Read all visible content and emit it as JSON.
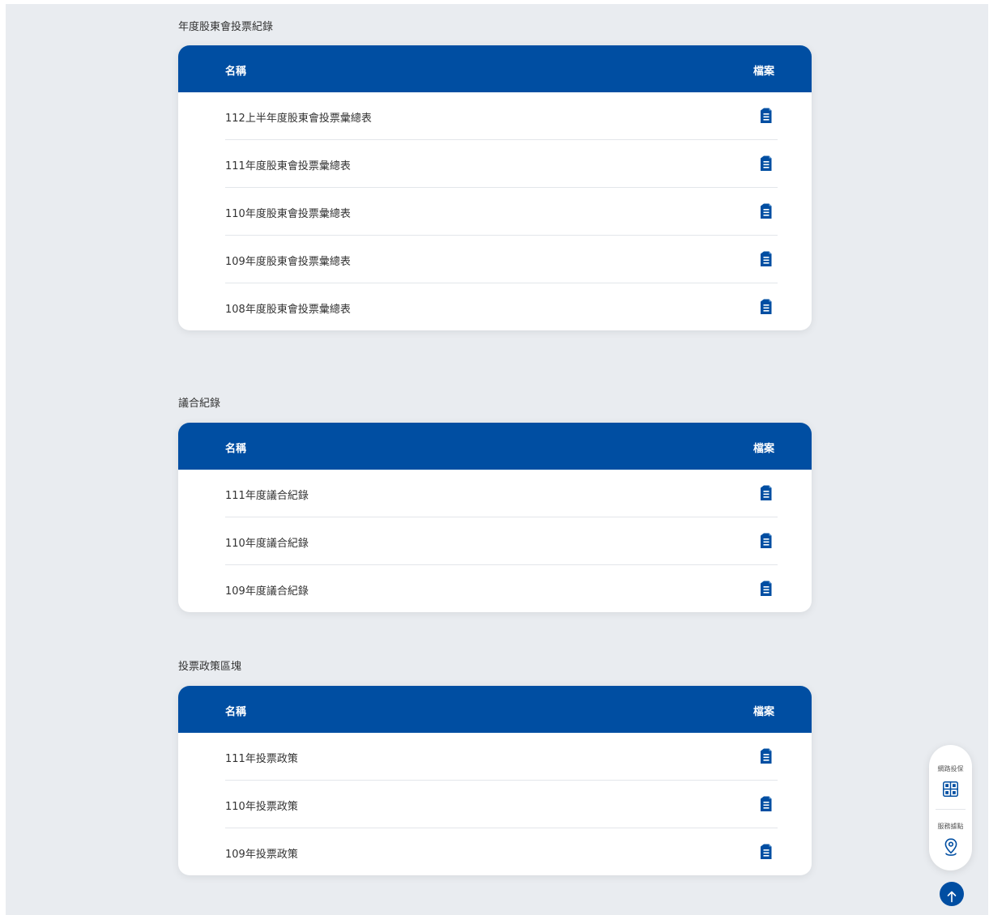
{
  "sections": [
    {
      "title": "年度股東會投票紀錄",
      "header": {
        "name": "名稱",
        "file": "檔案"
      },
      "rows": [
        {
          "name": "112上半年度股東會投票彙總表",
          "file_icon": "document-icon"
        },
        {
          "name": "111年度股東會投票彙總表",
          "file_icon": "document-icon"
        },
        {
          "name": "110年度股東會投票彙總表",
          "file_icon": "document-icon"
        },
        {
          "name": "109年度股東會投票彙總表",
          "file_icon": "document-icon"
        },
        {
          "name": "108年度股東會投票彙總表",
          "file_icon": "document-icon"
        }
      ]
    },
    {
      "title": "議合紀錄",
      "header": {
        "name": "名稱",
        "file": "檔案"
      },
      "rows": [
        {
          "name": "111年度議合紀錄",
          "file_icon": "document-icon"
        },
        {
          "name": "110年度議合紀錄",
          "file_icon": "document-icon"
        },
        {
          "name": "109年度議合紀錄",
          "file_icon": "document-icon"
        }
      ]
    },
    {
      "title": "投票政策區塊",
      "header": {
        "name": "名稱",
        "file": "檔案"
      },
      "rows": [
        {
          "name": "111年投票政策",
          "file_icon": "document-icon"
        },
        {
          "name": "110年投票政策",
          "file_icon": "document-icon"
        },
        {
          "name": "109年投票政策",
          "file_icon": "document-icon"
        }
      ]
    }
  ],
  "floating_menu": {
    "items": [
      {
        "label": "網路投保",
        "icon": "grid-icon"
      },
      {
        "label": "服務據點",
        "icon": "location-pin-icon"
      }
    ],
    "back_to_top_icon": "arrow-up-icon"
  },
  "colors": {
    "brand_blue": "#004ea2",
    "page_background": "#e9ecf0",
    "card_background": "#ffffff"
  }
}
